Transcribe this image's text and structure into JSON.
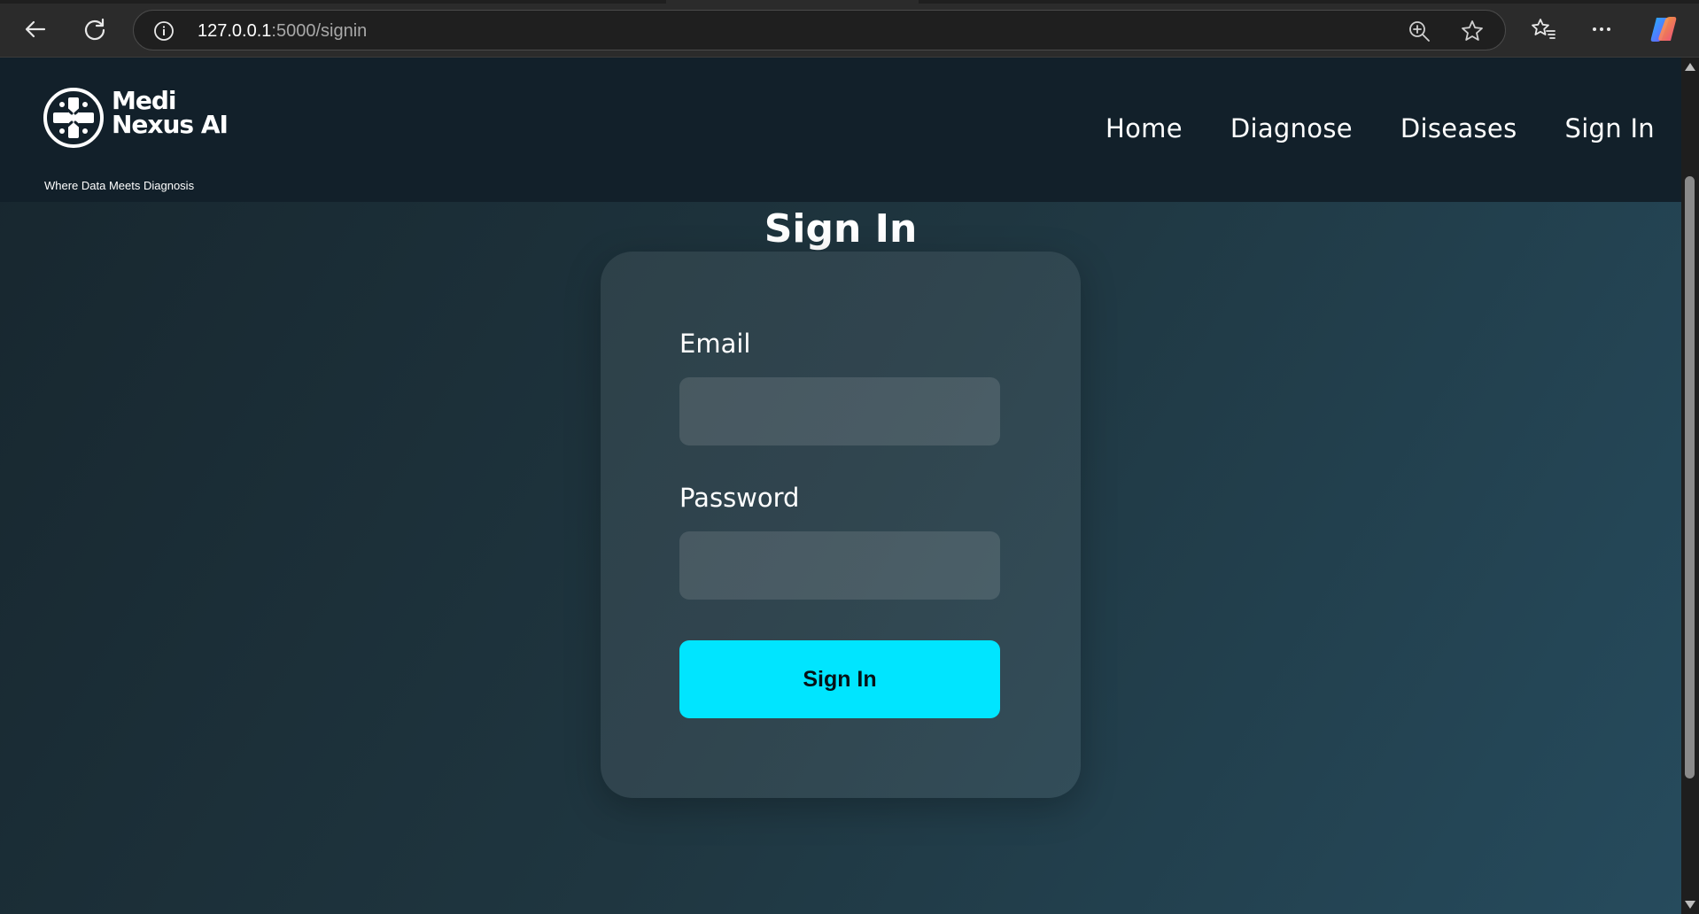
{
  "browser": {
    "url_host": "127.0.0.1",
    "url_rest": ":5000/signin",
    "icons": [
      "back-arrow-icon",
      "reload-icon",
      "info-icon",
      "zoom-icon",
      "star-icon",
      "favorites-icon",
      "more-icon",
      "copilot-icon"
    ]
  },
  "site": {
    "logo_line1": "Medi",
    "logo_line2": "Nexus AI",
    "tagline": "Where Data Meets Diagnosis",
    "nav": [
      {
        "label": "Home"
      },
      {
        "label": "Diagnose"
      },
      {
        "label": "Diseases"
      },
      {
        "label": "Sign In"
      }
    ]
  },
  "signin": {
    "title": "Sign In",
    "email_label": "Email",
    "email_value": "",
    "password_label": "Password",
    "password_value": "",
    "submit_label": "Sign In"
  },
  "colors": {
    "header_bg": "#12202a",
    "accent": "#00e5ff",
    "card_bg": "rgba(255,255,255,0.08)"
  }
}
